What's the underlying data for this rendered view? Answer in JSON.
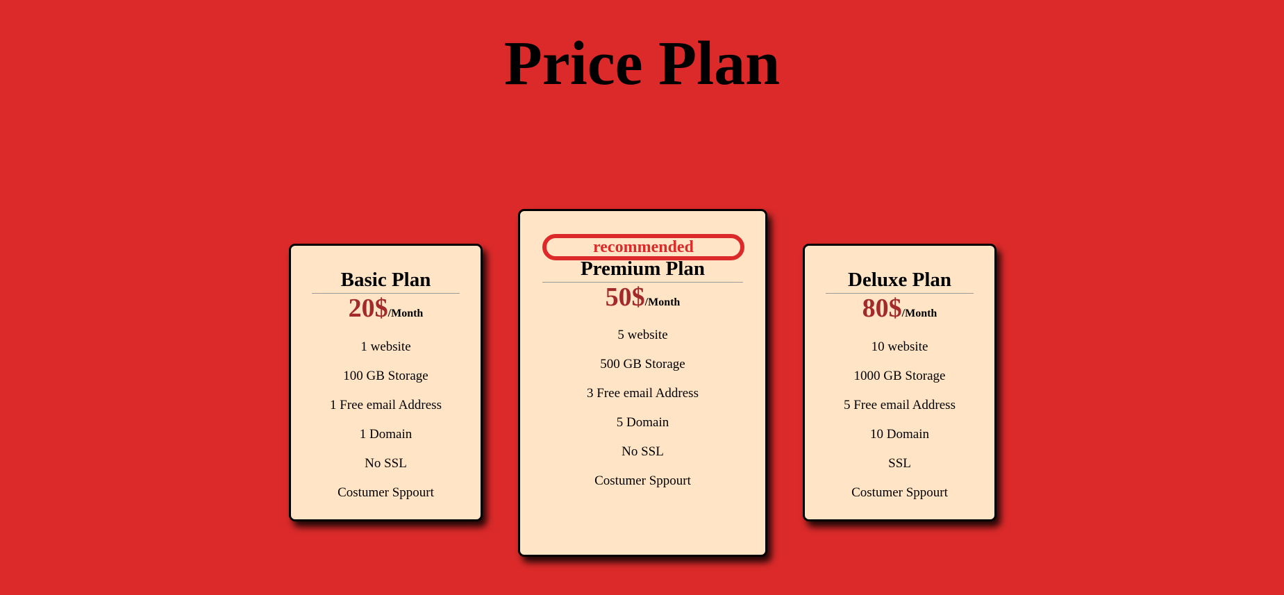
{
  "page": {
    "title": "Price Plan"
  },
  "colors": {
    "background": "#dc2a2a",
    "card": "#ffe5c6",
    "price": "#a32a2a",
    "badge": "#dc2a2a"
  },
  "plans": [
    {
      "name": "Basic Plan",
      "price": "20$",
      "period": "/Month",
      "features": [
        "1 website",
        "100 GB Storage",
        "1 Free email Address",
        "1 Domain",
        "No SSL",
        "Costumer Sppourt"
      ]
    },
    {
      "badge": "recommended",
      "name": "Premium Plan",
      "price": "50$",
      "period": "/Month",
      "features": [
        "5 website",
        "500 GB Storage",
        "3 Free email Address",
        "5 Domain",
        "No SSL",
        "Costumer Sppourt"
      ]
    },
    {
      "name": "Deluxe Plan",
      "price": "80$",
      "period": "/Month",
      "features": [
        "10 website",
        "1000 GB Storage",
        "5 Free email Address",
        "10 Domain",
        "SSL",
        "Costumer Sppourt"
      ]
    }
  ]
}
